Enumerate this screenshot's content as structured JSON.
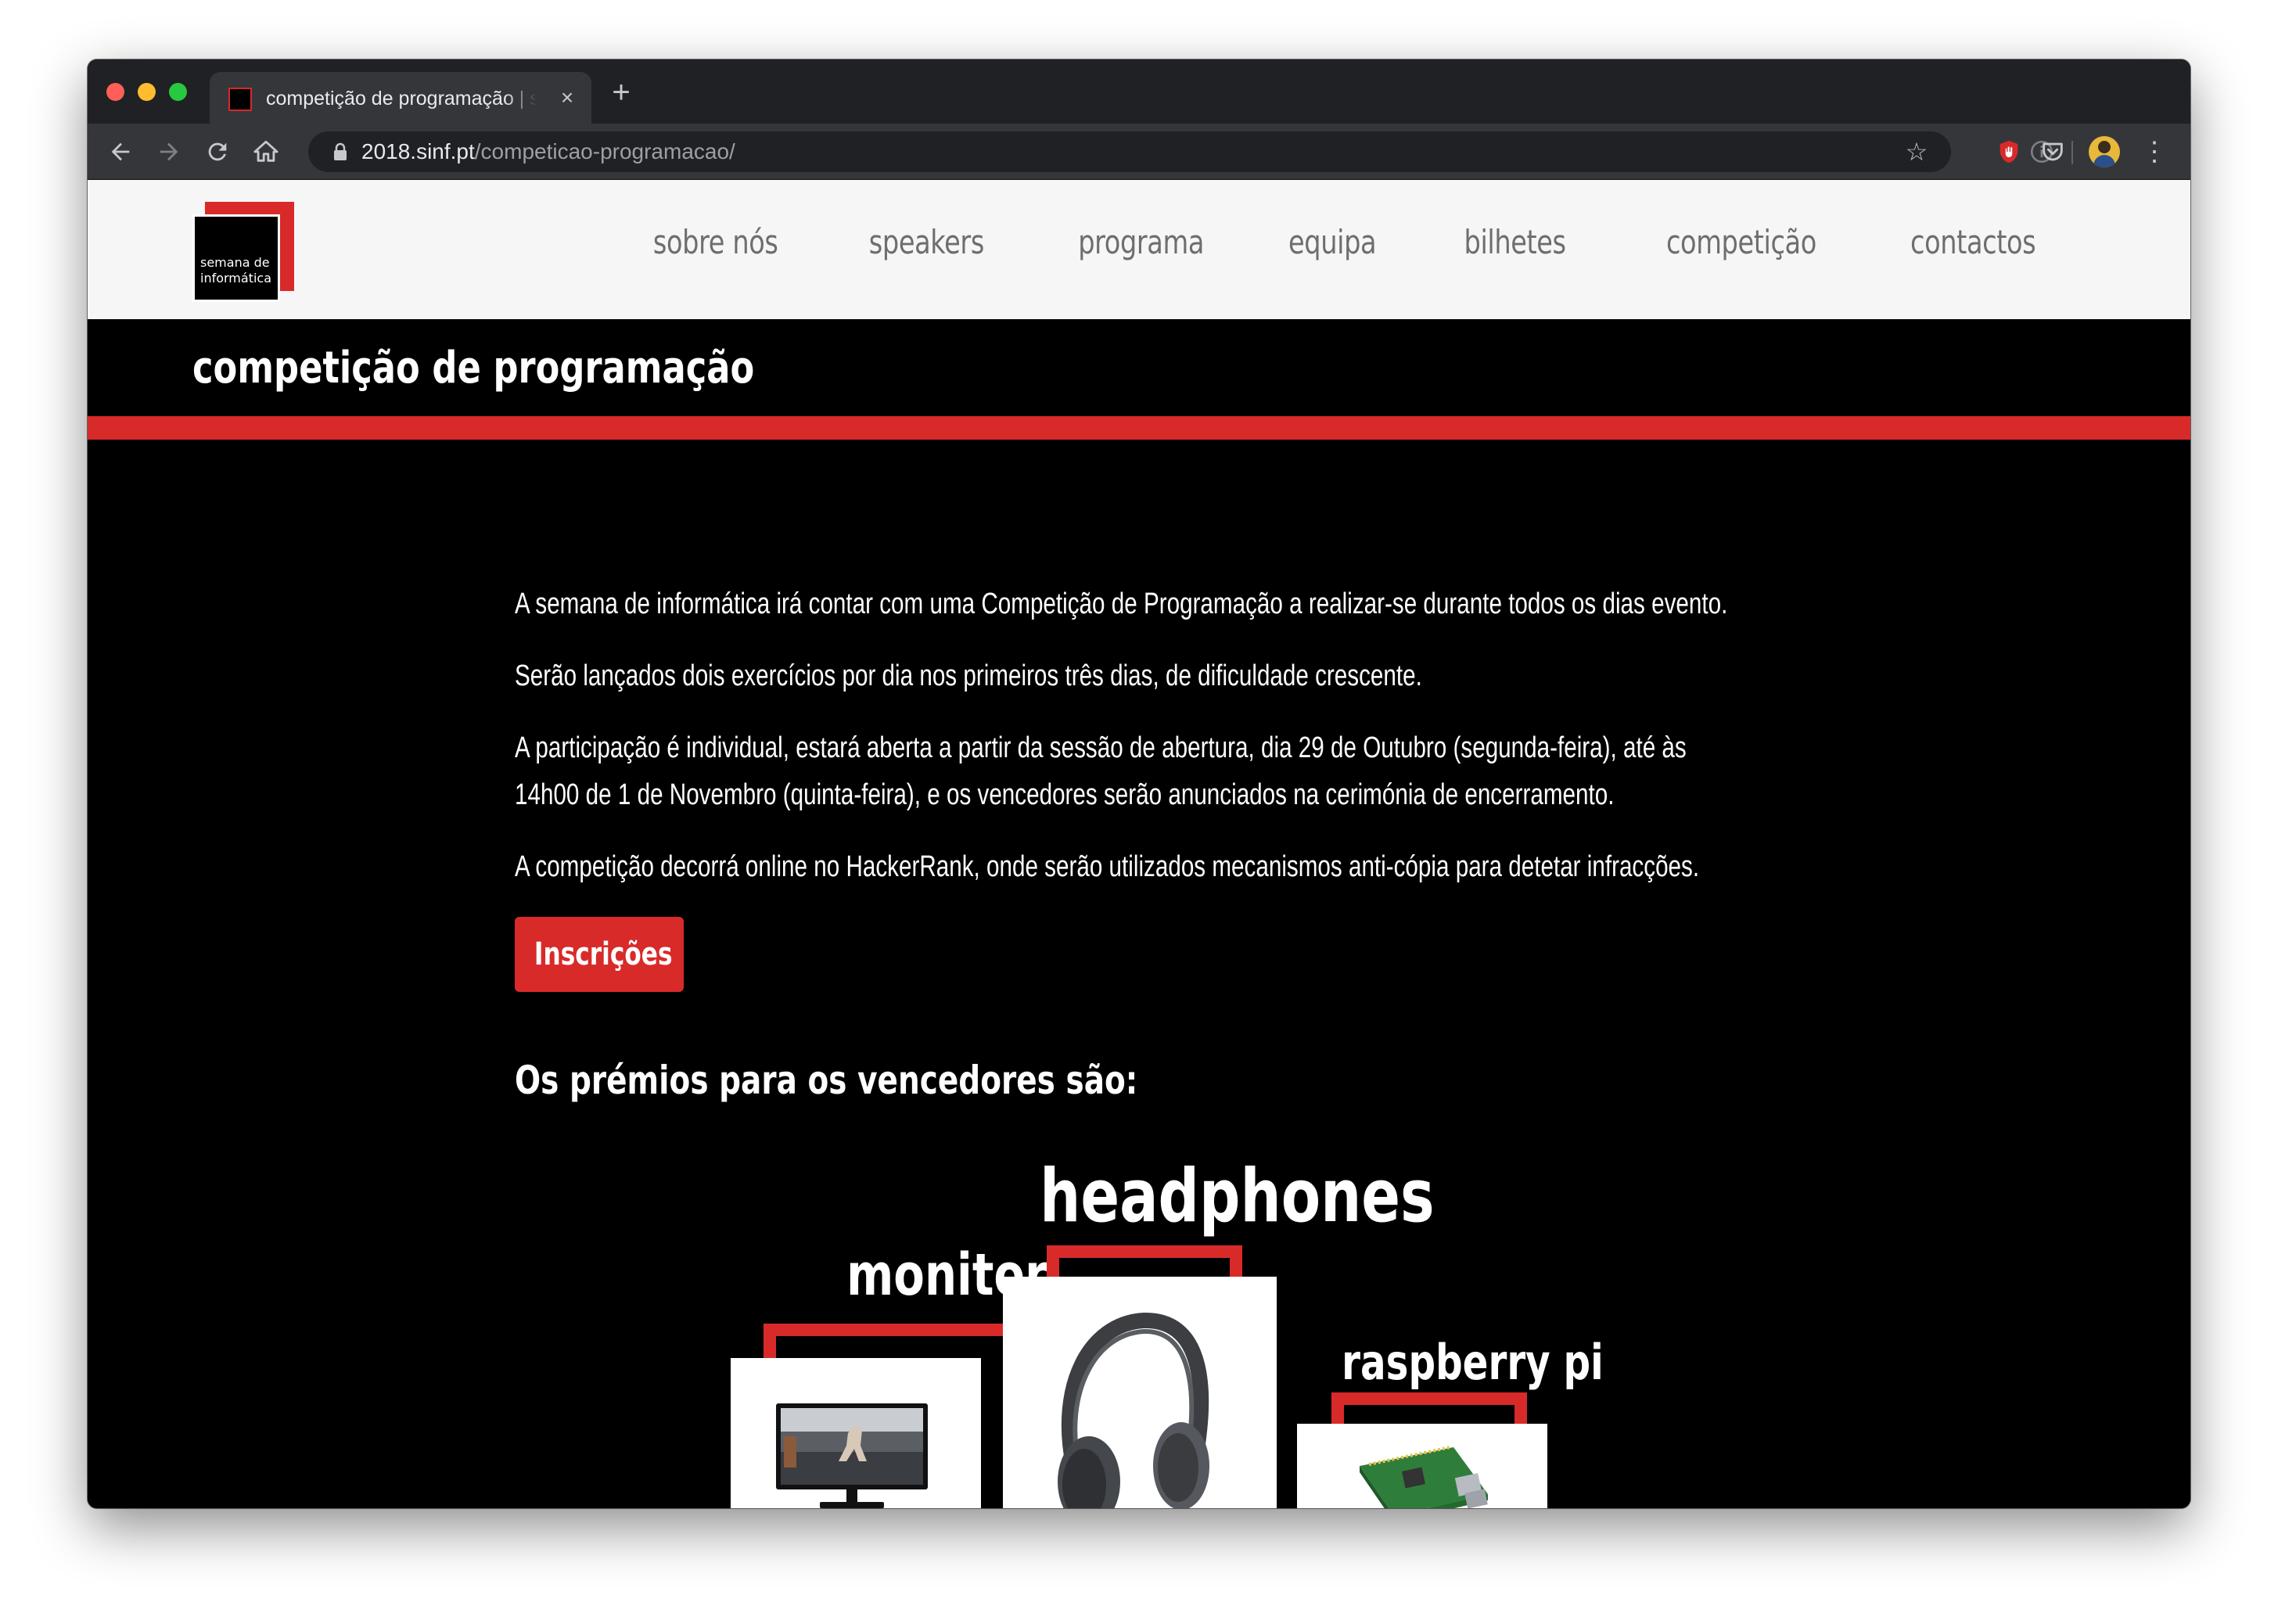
{
  "browser": {
    "tab_title": "competição de programação | semana de informática",
    "tab_close": "×",
    "new_tab": "+",
    "url_host": "2018.sinf.pt",
    "url_path": "/competicao-programacao/",
    "star": "☆",
    "menu": "⋮"
  },
  "site": {
    "logo_text": "semana de informática",
    "nav": [
      "sobre nós",
      "speakers",
      "programa",
      "equipa",
      "bilhetes",
      "competição",
      "contactos"
    ]
  },
  "page": {
    "title": "competição de programação",
    "paragraphs": [
      "A semana de informática irá contar com uma Competição de Programação a realizar-se durante todos os dias evento.",
      "Serão lançados dois exercícios por dia nos primeiros três dias, de dificuldade crescente.",
      "A participação é individual, estará aberta a partir da sessão de abertura, dia 29 de Outubro (segunda-feira), até às 14h00 de 1 de Novembro (quinta-feira), e os vencedores serão anunciados na cerimónia de encerramento.",
      "A competição decorrá online no HackerRank, onde serão utilizados mecanismos anti-cópia para detetar infracções."
    ],
    "register_button": "Inscrições",
    "prizes_heading": "Os prémios para os vencedores são:",
    "prizes": [
      {
        "label": "monitor",
        "place": "2"
      },
      {
        "label": "headphones",
        "place": "1"
      },
      {
        "label": "raspberry pi",
        "place": "3"
      }
    ]
  },
  "colors": {
    "accent_red": "#d92a2a",
    "header_bg": "#f6f6f6",
    "nav_text": "#6e6e6e",
    "content_bg": "#000000"
  },
  "icons": {
    "back": "arrow-left-icon",
    "forward": "arrow-right-icon",
    "reload": "reload-icon",
    "home": "home-icon",
    "lock": "lock-icon",
    "star": "star-icon",
    "extensions": [
      "ublock-icon",
      "info-icon",
      "pocket-icon"
    ]
  }
}
